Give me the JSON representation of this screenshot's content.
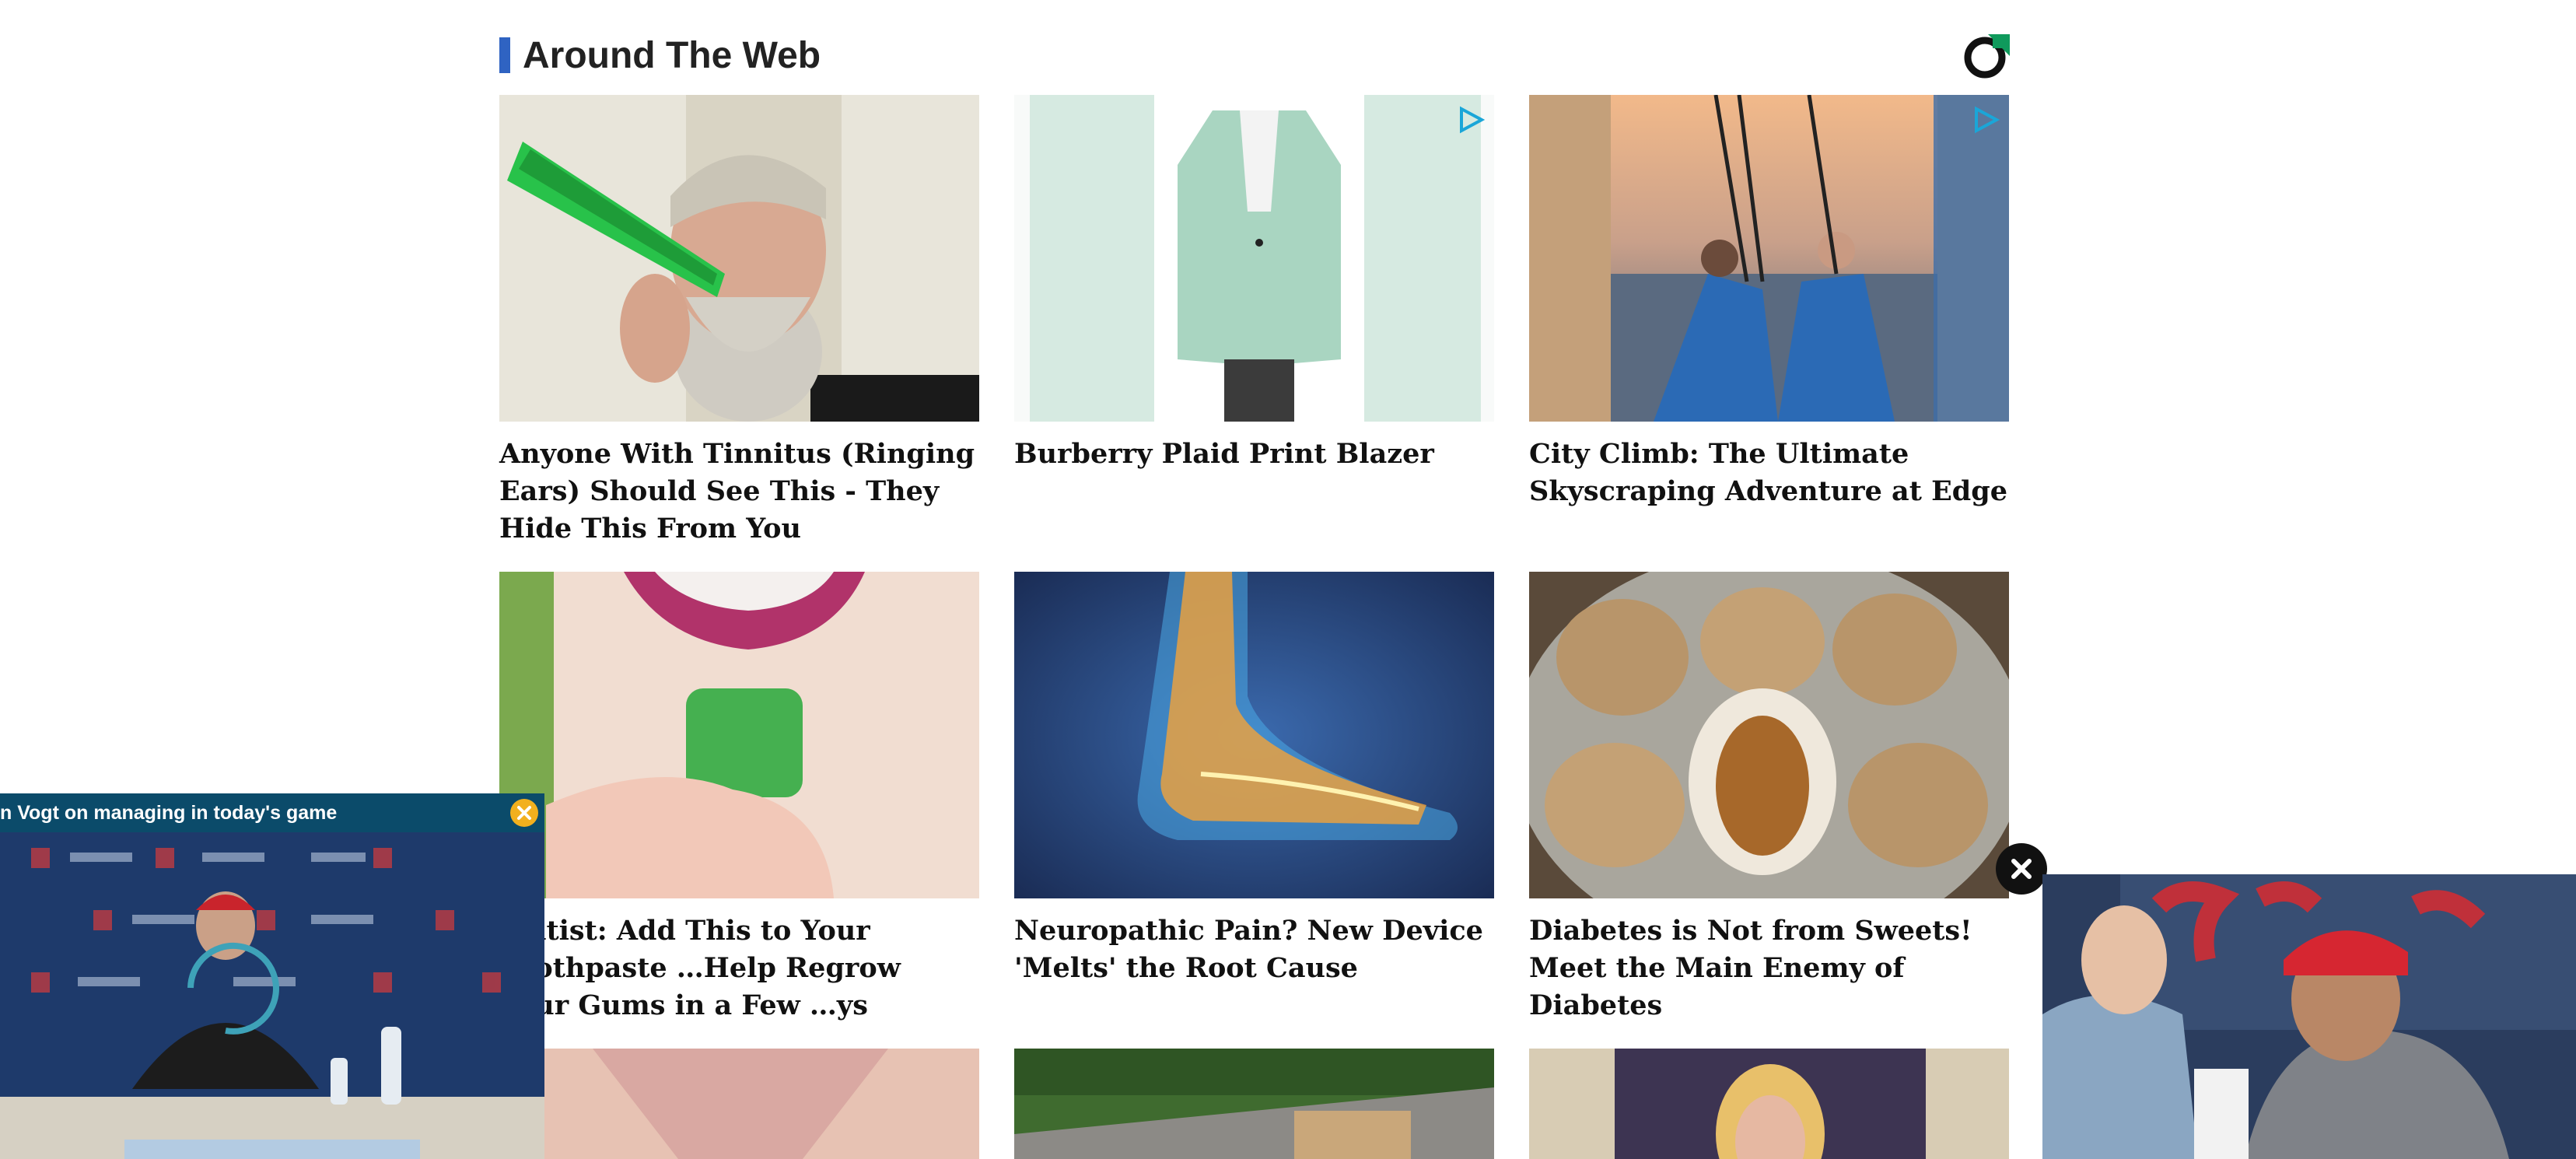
{
  "section": {
    "title": "Around The Web"
  },
  "colors": {
    "accent": "#2f63c2",
    "logo_green": "#0f9a5c",
    "popup_bar": "#0b4b6a",
    "popup_close": "#f2b01e"
  },
  "cards": [
    {
      "headline": "Anyone With Tinnitus (Ringing Ears) Should See This - They Hide This From You",
      "image": "man-with-green-bottle-at-ear",
      "sponsored_icon": false
    },
    {
      "headline": "Burberry Plaid Print Blazer",
      "image": "mint-plaid-blazer",
      "sponsored_icon": true
    },
    {
      "headline": "City Climb: The Ultimate Skyscraping Adventure at Edge",
      "image": "two-climbers-over-city",
      "sponsored_icon": true
    },
    {
      "headline": "…ntist: Add This to Your Toothpaste …Help Regrow Your Gums in a Few …ys",
      "image": "green-gummy-cube",
      "sponsored_icon": false
    },
    {
      "headline": "Neuropathic Pain? New Device 'Melts' the Root Cause",
      "image": "glowing-foot-xray",
      "sponsored_icon": false
    },
    {
      "headline": "Diabetes is Not from Sweets! Meet the Main Enemy of Diabetes",
      "image": "walnuts-bowl",
      "sponsored_icon": false
    },
    {
      "headline": "",
      "image": "partial-pink-top",
      "sponsored_icon": false
    },
    {
      "headline": "",
      "image": "roof-with-trees",
      "sponsored_icon": false
    },
    {
      "headline": "",
      "image": "woman-poster",
      "sponsored_icon": false
    }
  ],
  "video_left": {
    "title": "n Vogt on managing in today's game"
  },
  "icons": {
    "logo": "brand-logo-icon",
    "adchoice": "adchoices-icon",
    "close": "close-icon"
  }
}
